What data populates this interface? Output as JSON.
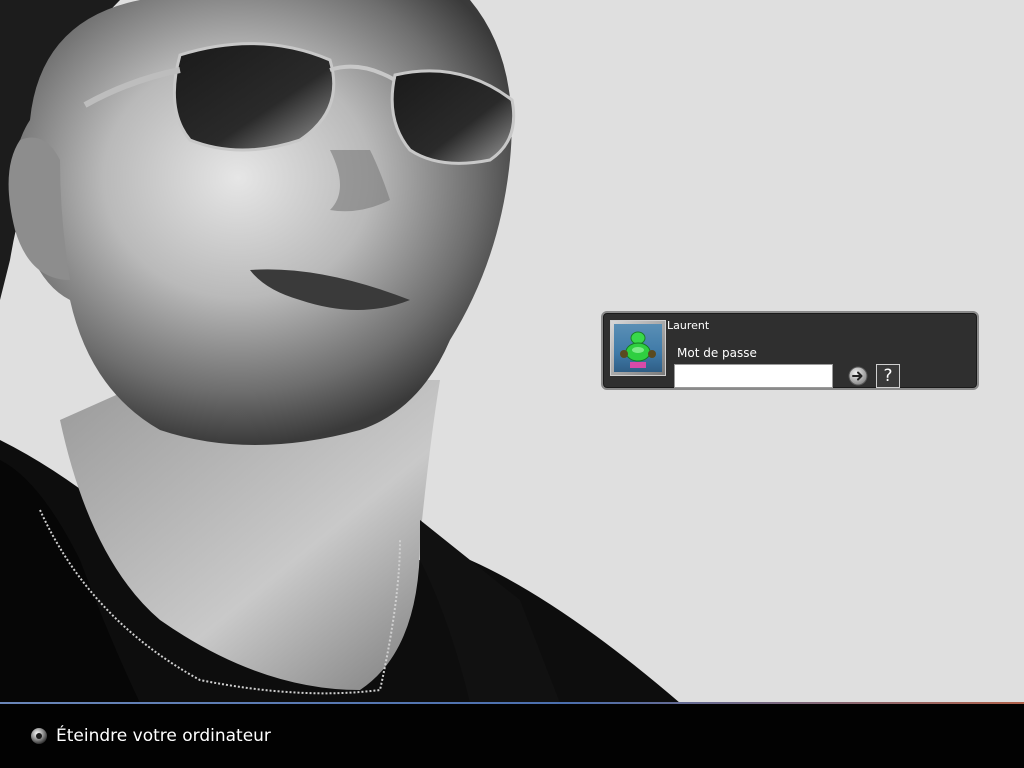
{
  "login": {
    "user_name": "Laurent",
    "password_label": "Mot de passe",
    "password_value": "",
    "help_label": "?"
  },
  "footer": {
    "shutdown_label": "Éteindre votre ordinateur"
  },
  "icons": {
    "go": "arrow-right-icon",
    "shutdown": "power-icon",
    "avatar": "green-frog-figure"
  },
  "colors": {
    "panel_bg": "#2f2f2f",
    "panel_border": "#8a8a8a",
    "screen_bg": "#dfdfdf",
    "bottom_bar": "#020202",
    "accent_line": "#4b6fae"
  }
}
